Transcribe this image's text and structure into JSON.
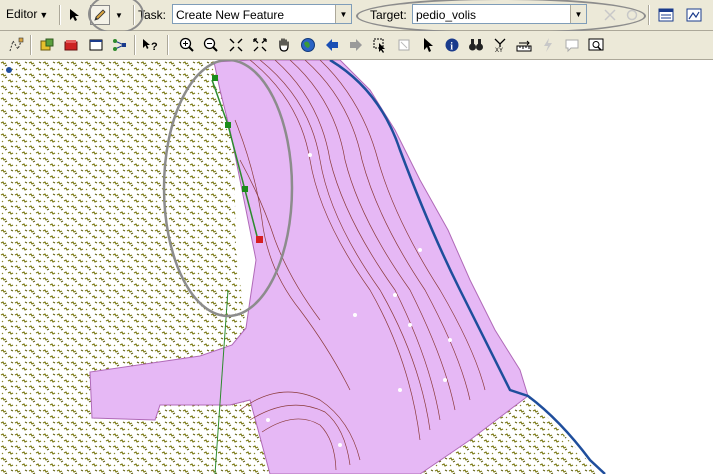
{
  "editor": {
    "menu_label": "Editor",
    "task_label": "Task:",
    "task_value": "Create New Feature",
    "target_label": "Target:",
    "target_value": "pedio_volis"
  },
  "colors": {
    "polygon_fill": "#e6b8f5",
    "polygon_edge": "#b06ab8",
    "vegetation": "#7b7a16",
    "river": "#1f4e9c",
    "contour": "#8b3a3a",
    "sketch_line": "#2e8b2e",
    "vertex_green": "#1a8c1a",
    "vertex_red": "#d62020",
    "highlight_circle": "#8c8c8c"
  },
  "toolbar_icons": [
    "arrow-pointer-icon",
    "pencil-sketch-icon",
    "attributes-icon",
    "sketch-properties-icon",
    "edit-vertices-icon",
    "topology-icon",
    "layer-icon",
    "rectangle-select-icon",
    "network-icon",
    "whats-this-icon",
    "zoom-in-icon",
    "zoom-out-icon",
    "fixed-zoom-in-icon",
    "fixed-zoom-out-icon",
    "pan-hand-icon",
    "full-extent-globe-icon",
    "back-arrow-icon",
    "forward-arrow-icon",
    "select-features-icon",
    "clear-selection-icon",
    "select-elements-icon",
    "identify-icon",
    "find-binoculars-icon",
    "go-to-xy-icon",
    "measure-icon",
    "hyperlink-icon",
    "html-popup-icon",
    "overview-icon"
  ]
}
